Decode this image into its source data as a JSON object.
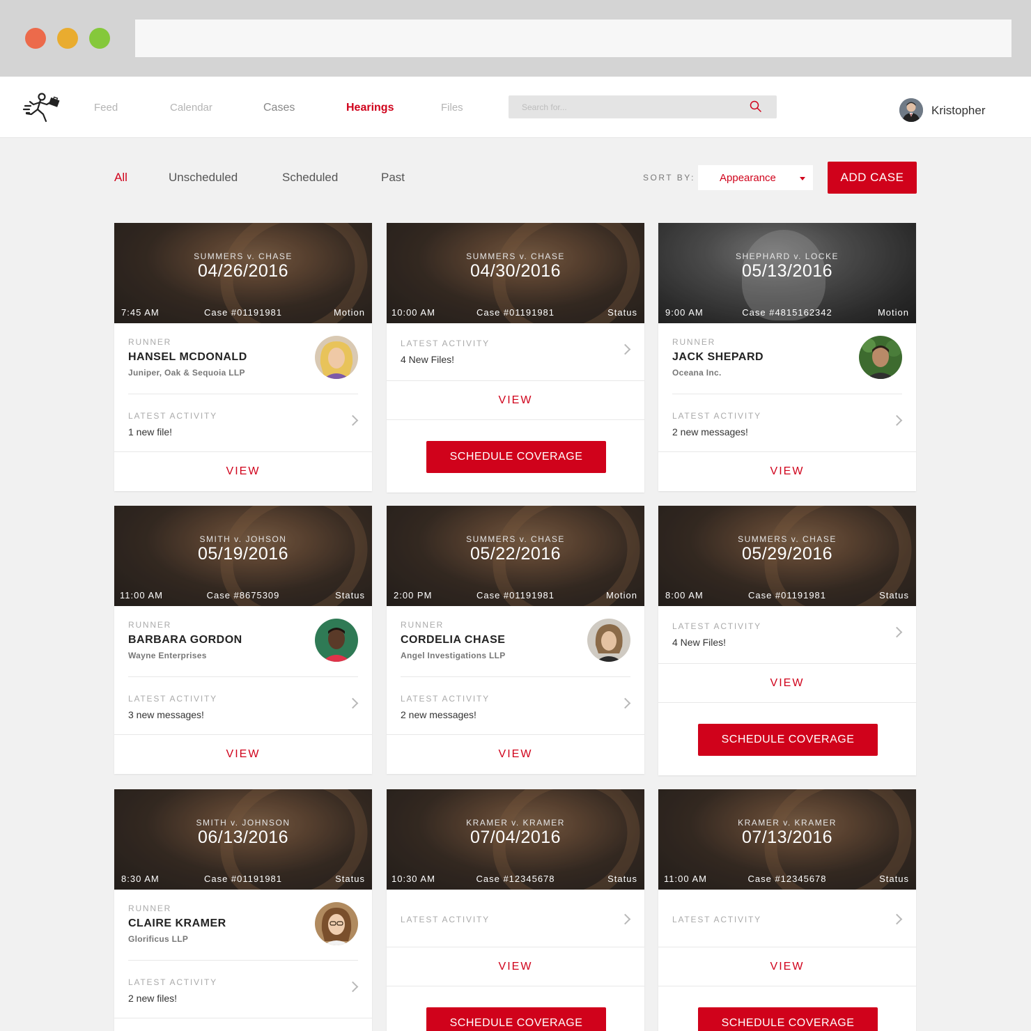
{
  "nav": {
    "items": [
      "Feed",
      "Calendar",
      "Cases",
      "Hearings",
      "Files"
    ],
    "search_placeholder": "Search for...",
    "user_name": "Kristopher"
  },
  "toolbar": {
    "filters": [
      "All",
      "Unscheduled",
      "Scheduled",
      "Past"
    ],
    "sort_label": "SORT BY:",
    "sort_value": "Appearance",
    "add_case": "ADD CASE"
  },
  "labels": {
    "runner": "RUNNER",
    "latest_activity": "LATEST ACTIVITY",
    "view": "VIEW",
    "schedule": "SCHEDULE COVERAGE"
  },
  "colors": {
    "accent": "#d0021b"
  },
  "cards": [
    {
      "case": "SUMMERS v. CHASE",
      "date": "04/26/2016",
      "time": "7:45 AM",
      "number": "Case #01191981",
      "type": "Motion",
      "runner": "HANSEL MCDONALD",
      "firm": "Juniper, Oak & Sequoia LLP",
      "activity": "1 new file!"
    },
    {
      "case": "SUMMERS v. CHASE",
      "date": "04/30/2016",
      "time": "10:00 AM",
      "number": "Case #01191981",
      "type": "Status",
      "activity": "4 New Files!"
    },
    {
      "case": "SHEPHARD v. LOCKE",
      "date": "05/13/2016",
      "time": "9:00 AM",
      "number": "Case #4815162342",
      "type": "Motion",
      "runner": "JACK SHEPARD",
      "firm": "Oceana Inc.",
      "activity": "2 new messages!"
    },
    {
      "case": "SMITH v. JOHSON",
      "date": "05/19/2016",
      "time": "11:00 AM",
      "number": "Case #8675309",
      "type": "Status",
      "runner": "BARBARA GORDON",
      "firm": "Wayne Enterprises",
      "activity": "3 new messages!"
    },
    {
      "case": "SUMMERS v. CHASE",
      "date": "05/22/2016",
      "time": "2:00 PM",
      "number": "Case #01191981",
      "type": "Motion",
      "runner": "CORDELIA CHASE",
      "firm": "Angel Investigations LLP",
      "activity": "2 new messages!"
    },
    {
      "case": "SUMMERS v. CHASE",
      "date": "05/29/2016",
      "time": "8:00 AM",
      "number": "Case #01191981",
      "type": "Status",
      "activity": "4 New Files!"
    },
    {
      "case": "SMITH v. JOHNSON",
      "date": "06/13/2016",
      "time": "8:30 AM",
      "number": "Case #01191981",
      "type": "Status",
      "runner": "CLAIRE KRAMER",
      "firm": "Glorificus LLP",
      "activity": "2 new files!"
    },
    {
      "case": "KRAMER v. KRAMER",
      "date": "07/04/2016",
      "time": "10:30 AM",
      "number": "Case #12345678",
      "type": "Status",
      "activity": ""
    },
    {
      "case": "KRAMER v. KRAMER",
      "date": "07/13/2016",
      "time": "11:00 AM",
      "number": "Case #12345678",
      "type": "Status",
      "activity": ""
    }
  ]
}
